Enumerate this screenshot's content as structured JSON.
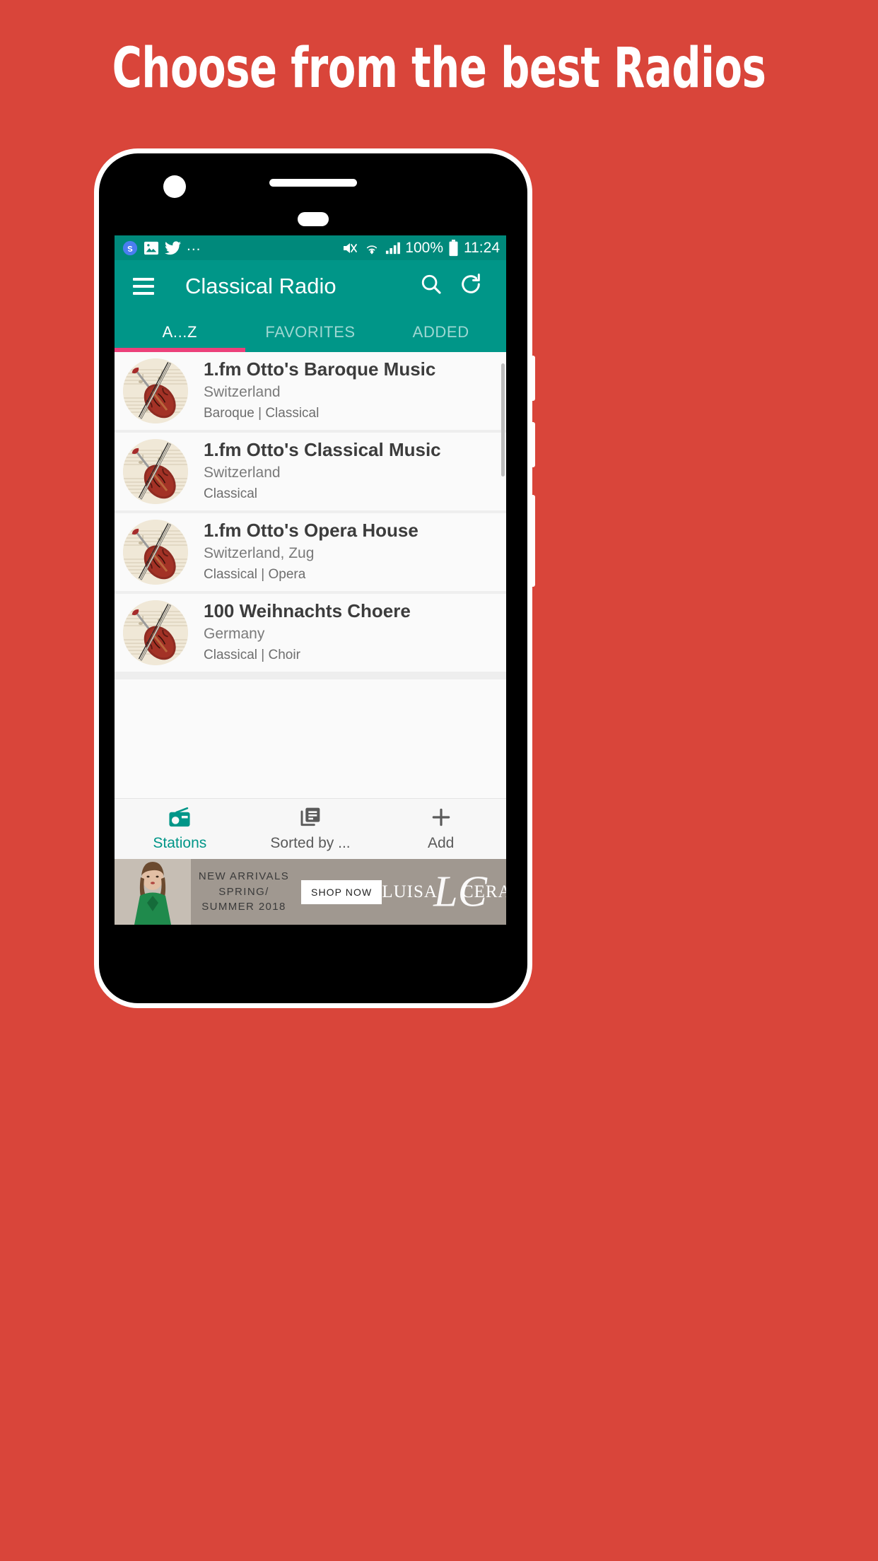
{
  "promo": {
    "headline": "Choose from the best Radios",
    "background_color": "#D9453A"
  },
  "theme": {
    "primary": "#009688",
    "primary_dark": "#00897B",
    "accent": "#EC407A",
    "surface": "#FAFAFA"
  },
  "statusbar": {
    "left_icons": [
      "skype-icon",
      "image-icon",
      "twitter-icon"
    ],
    "overflow": "...",
    "right_icons": [
      "mute-icon",
      "wifi-icon",
      "signal-icon",
      "battery-icon"
    ],
    "battery_text": "100%",
    "time": "11:24"
  },
  "appbar": {
    "menu_icon": "hamburger-icon",
    "title": "Classical Radio",
    "search_icon": "search-icon",
    "refresh_icon": "refresh-icon"
  },
  "tabs": {
    "items": [
      {
        "label": "A...Z",
        "active": true
      },
      {
        "label": "FAVORITES",
        "active": false
      },
      {
        "label": "ADDED",
        "active": false
      }
    ]
  },
  "stations": [
    {
      "title": "1.fm Otto's Baroque Music",
      "country": "Switzerland",
      "tags": "Baroque | Classical",
      "avatar": "violin-sheet-music-icon"
    },
    {
      "title": "1.fm Otto's Classical Music",
      "country": "Switzerland",
      "tags": "Classical",
      "avatar": "violin-sheet-music-icon"
    },
    {
      "title": "1.fm Otto's Opera House",
      "country": "Switzerland, Zug",
      "tags": "Classical | Opera",
      "avatar": "violin-sheet-music-icon"
    },
    {
      "title": "100  Weihnachts Choere",
      "country": "Germany",
      "tags": "Classical | Choir",
      "avatar": "violin-sheet-music-icon"
    }
  ],
  "bottomnav": {
    "items": [
      {
        "label": "Stations",
        "icon": "radio-icon",
        "active": true
      },
      {
        "label": "Sorted by ...",
        "icon": "list-icon",
        "active": false
      },
      {
        "label": "Add",
        "icon": "plus-icon",
        "active": false
      }
    ]
  },
  "ad": {
    "line1": "NEW ARRIVALS",
    "line2": "SPRING/",
    "line3": "SUMMER 2018",
    "cta": "SHOP NOW",
    "brand_left": "LUISA",
    "brand_right": "CERANO",
    "brand_monogram": "LC",
    "adchoices_icon": "adchoices-icon",
    "close_icon": "close-icon"
  }
}
